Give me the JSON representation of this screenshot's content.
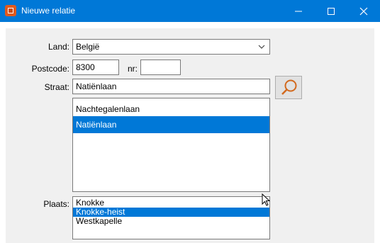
{
  "window": {
    "title": "Nieuwe relatie",
    "accent": "#0078d7",
    "icons": {
      "app": "app-icon",
      "minimize": "minimize-icon",
      "maximize": "maximize-icon",
      "close": "close-icon"
    }
  },
  "form": {
    "country_label": "Land:",
    "country_value": "België",
    "postcode_label": "Postcode:",
    "postcode_value": "8300",
    "number_label": "nr:",
    "number_value": "",
    "street_label": "Straat:",
    "street_value": "Natiënlaan",
    "search_icon": "magnifier-icon",
    "street_list": [
      {
        "label": "Nachtegalenlaan",
        "selected": false
      },
      {
        "label": "Natiënlaan",
        "selected": true
      }
    ],
    "place_label": "Plaats:",
    "place_list": [
      {
        "label": "Knokke",
        "selected": false
      },
      {
        "label": "Knokke-heist",
        "selected": true
      },
      {
        "label": "Westkapelle",
        "selected": false
      }
    ],
    "selection_color": "#0078d7"
  }
}
